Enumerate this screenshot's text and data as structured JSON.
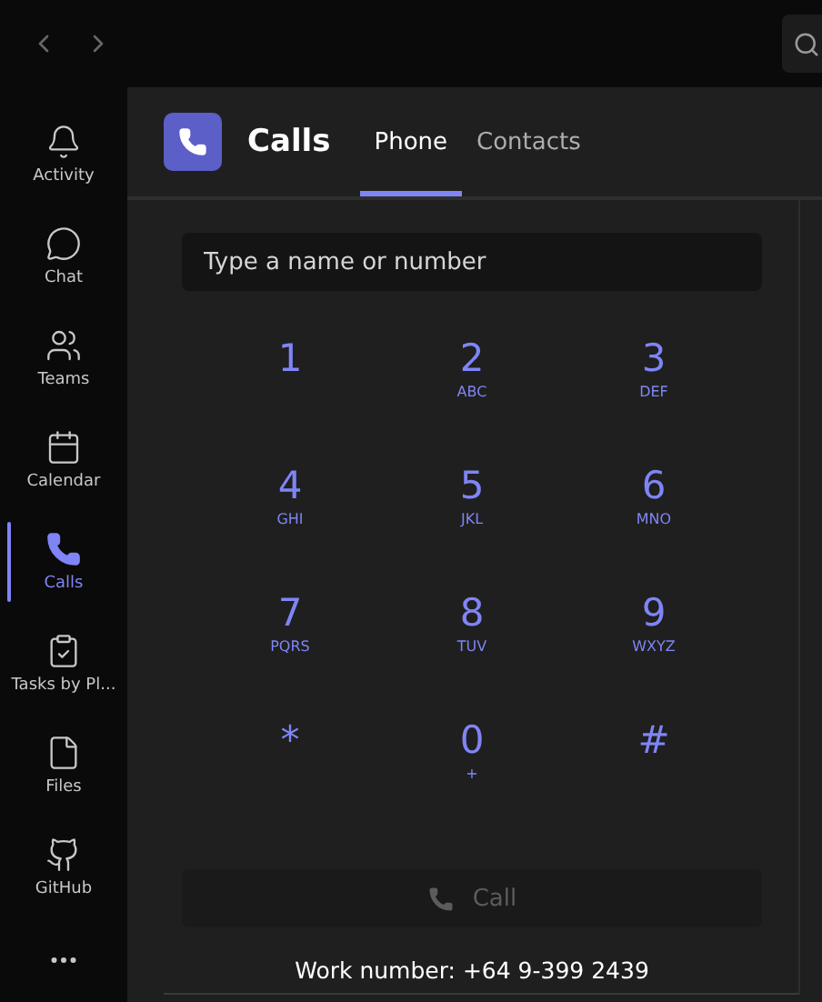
{
  "rail": [
    {
      "label": "Activity",
      "selected": false
    },
    {
      "label": "Chat",
      "selected": false
    },
    {
      "label": "Teams",
      "selected": false
    },
    {
      "label": "Calendar",
      "selected": false
    },
    {
      "label": "Calls",
      "selected": true
    },
    {
      "label": "Tasks by Pl...",
      "selected": false
    },
    {
      "label": "Files",
      "selected": false
    },
    {
      "label": "GitHub",
      "selected": false
    }
  ],
  "app": {
    "title": "Calls",
    "tabs": [
      {
        "label": "Phone",
        "selected": true
      },
      {
        "label": "Contacts",
        "selected": false
      }
    ]
  },
  "search": {
    "placeholder": "Type a name or number"
  },
  "keys": [
    {
      "digit": "1"
    },
    {
      "digit": "2",
      "letters": "ABC"
    },
    {
      "digit": "3",
      "letters": "DEF"
    },
    {
      "digit": "4",
      "letters": "GHI"
    },
    {
      "digit": "5",
      "letters": "JKL"
    },
    {
      "digit": "6",
      "letters": "MNO"
    },
    {
      "digit": "7",
      "letters": "PQRS"
    },
    {
      "digit": "8",
      "letters": "TUV"
    },
    {
      "digit": "9",
      "letters": "WXYZ"
    },
    {
      "digit": "*"
    },
    {
      "digit": "0",
      "letters": "+"
    },
    {
      "digit": "#"
    }
  ],
  "call_button": {
    "label": "Call",
    "disabled": true
  },
  "work_number": "Work number: +64 9-399 2439"
}
